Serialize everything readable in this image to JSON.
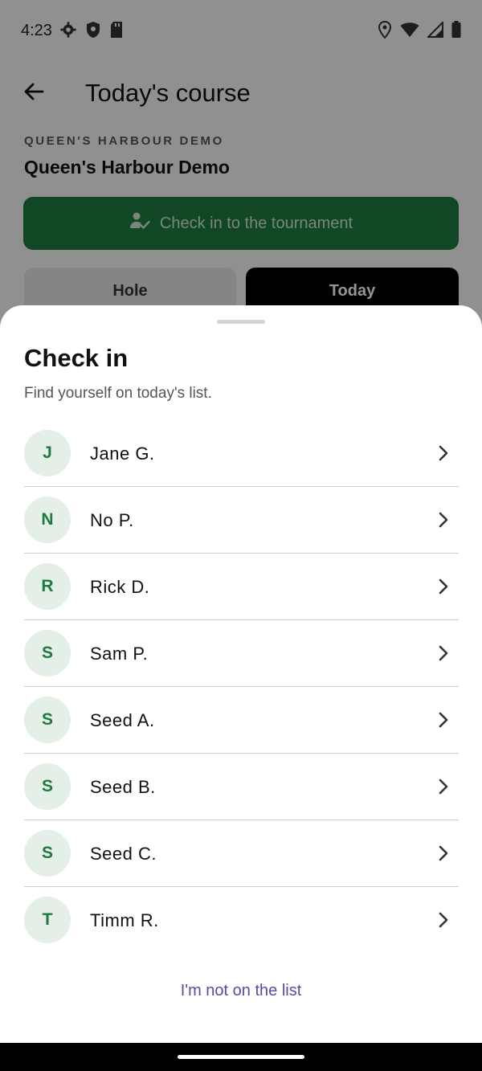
{
  "status_bar": {
    "time": "4:23",
    "left_icons": [
      "gear-icon",
      "shield-icon",
      "sd-card-icon"
    ],
    "right_icons": [
      "location-icon",
      "wifi-icon",
      "signal-icon",
      "battery-icon"
    ]
  },
  "app_bar": {
    "title": "Today's course"
  },
  "course": {
    "eyebrow": "QUEEN'S HARBOUR DEMO",
    "name": "Queen's Harbour Demo"
  },
  "check_in_button": {
    "label": "Check in to the tournament",
    "icon": "person-check-icon"
  },
  "segments": {
    "hole": "Hole",
    "today": "Today"
  },
  "sheet": {
    "title": "Check in",
    "subtitle": "Find yourself on today's list.",
    "players": [
      {
        "initial": "J",
        "name": "Jane G."
      },
      {
        "initial": "N",
        "name": "No P."
      },
      {
        "initial": "R",
        "name": "Rick D."
      },
      {
        "initial": "S",
        "name": "Sam P."
      },
      {
        "initial": "S",
        "name": "Seed A."
      },
      {
        "initial": "S",
        "name": "Seed B."
      },
      {
        "initial": "S",
        "name": "Seed C."
      },
      {
        "initial": "T",
        "name": "Timm R."
      }
    ],
    "not_on_list": "I'm not on the list"
  },
  "colors": {
    "primary_green": "#1e7a3e",
    "avatar_bg": "#e3efe7",
    "link_purple": "#5b4aa3"
  }
}
